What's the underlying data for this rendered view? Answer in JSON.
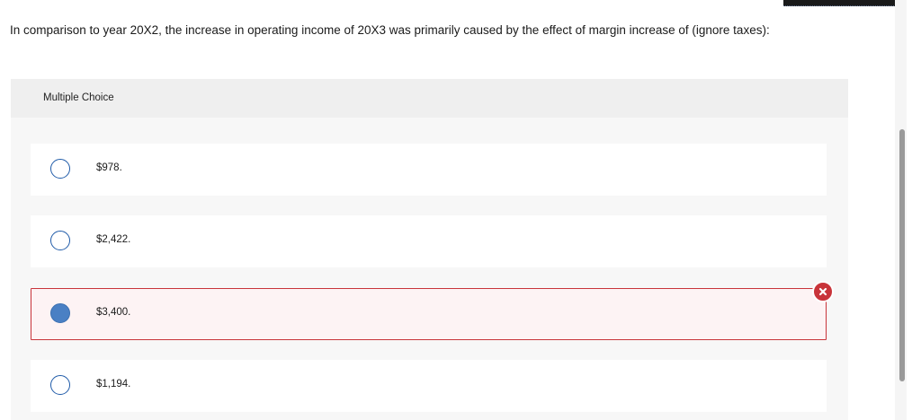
{
  "question": {
    "text": "In comparison to year 20X2, the increase in operating income of 20X3 was primarily caused by the effect of margin increase of (ignore taxes):"
  },
  "multiple_choice": {
    "header_label": "Multiple Choice",
    "options": [
      {
        "label": "$978.",
        "selected": false
      },
      {
        "label": "$2,422.",
        "selected": false
      },
      {
        "label": "$3,400.",
        "selected": true,
        "status": "incorrect"
      },
      {
        "label": "$1,194.",
        "selected": false
      }
    ]
  },
  "icons": {
    "incorrect_badge": "close-icon",
    "incorrect_color": "#c8343a",
    "accent_color": "#1e5aa8"
  }
}
